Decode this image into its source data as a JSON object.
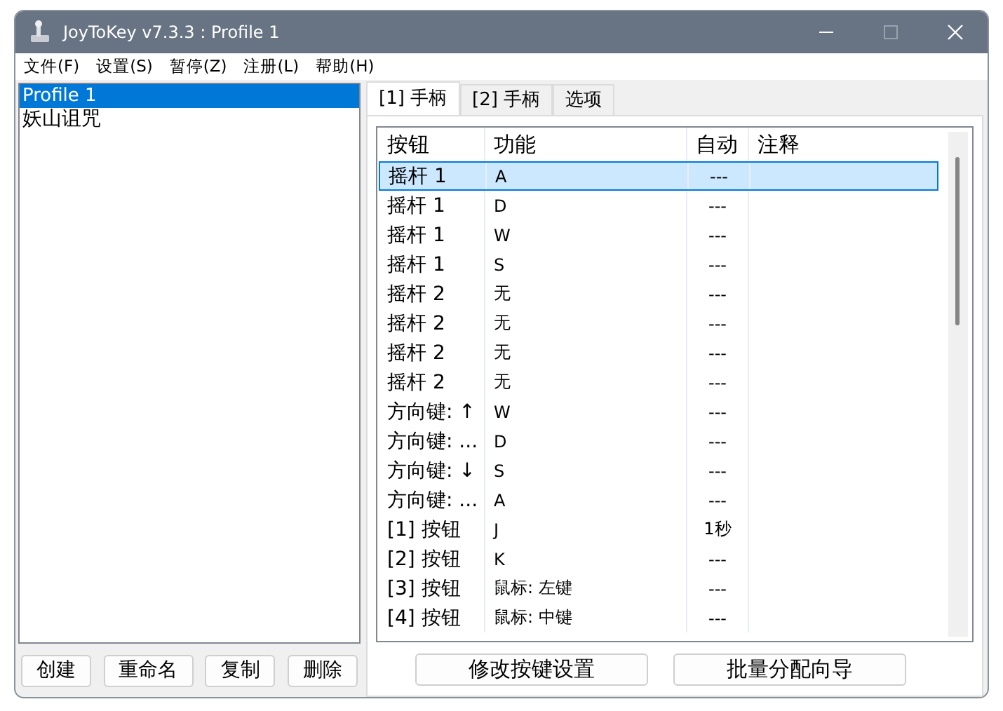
{
  "window": {
    "title": "JoyToKey v7.3.3 : Profile 1"
  },
  "menu": [
    "文件(F)",
    "设置(S)",
    "暂停(Z)",
    "注册(L)",
    "帮助(H)"
  ],
  "profiles": [
    {
      "label": "Profile 1",
      "selected": true
    },
    {
      "label": "妖山诅咒",
      "selected": false
    }
  ],
  "profile_buttons": [
    "创建",
    "重命名",
    "复制",
    "删除"
  ],
  "tabs": [
    {
      "label": "[1] 手柄",
      "selected": true
    },
    {
      "label": "[2] 手柄",
      "selected": false
    },
    {
      "label": "选项",
      "selected": false
    }
  ],
  "table": {
    "columns": [
      "按钮",
      "功能",
      "自动",
      "注释"
    ],
    "rows": [
      {
        "button": "摇杆 1",
        "function": "A",
        "auto": "---",
        "selected": true
      },
      {
        "button": "摇杆 1",
        "function": "D",
        "auto": "---",
        "selected": false
      },
      {
        "button": "摇杆 1",
        "function": "W",
        "auto": "---",
        "selected": false
      },
      {
        "button": "摇杆 1",
        "function": "S",
        "auto": "---",
        "selected": false
      },
      {
        "button": "摇杆 2",
        "function": "无",
        "auto": "---",
        "selected": false
      },
      {
        "button": "摇杆 2",
        "function": "无",
        "auto": "---",
        "selected": false
      },
      {
        "button": "摇杆 2",
        "function": "无",
        "auto": "---",
        "selected": false
      },
      {
        "button": "摇杆 2",
        "function": "无",
        "auto": "---",
        "selected": false
      },
      {
        "button": "方向键: ↑",
        "function": "W",
        "auto": "---",
        "selected": false
      },
      {
        "button": "方向键: ...",
        "function": "D",
        "auto": "---",
        "selected": false
      },
      {
        "button": "方向键: ↓",
        "function": "S",
        "auto": "---",
        "selected": false
      },
      {
        "button": "方向键: ...",
        "function": "A",
        "auto": "---",
        "selected": false
      },
      {
        "button": "[1] 按钮",
        "function": "J",
        "auto": "1秒",
        "selected": false
      },
      {
        "button": "[2] 按钮",
        "function": "K",
        "auto": "---",
        "selected": false
      },
      {
        "button": "[3] 按钮",
        "function": "鼠标: 左键",
        "auto": "---",
        "selected": false
      },
      {
        "button": "[4] 按钮",
        "function": "鼠标: 中键",
        "auto": "---",
        "selected": false
      }
    ]
  },
  "bottom_buttons": [
    "修改按键设置",
    "批量分配向导"
  ]
}
